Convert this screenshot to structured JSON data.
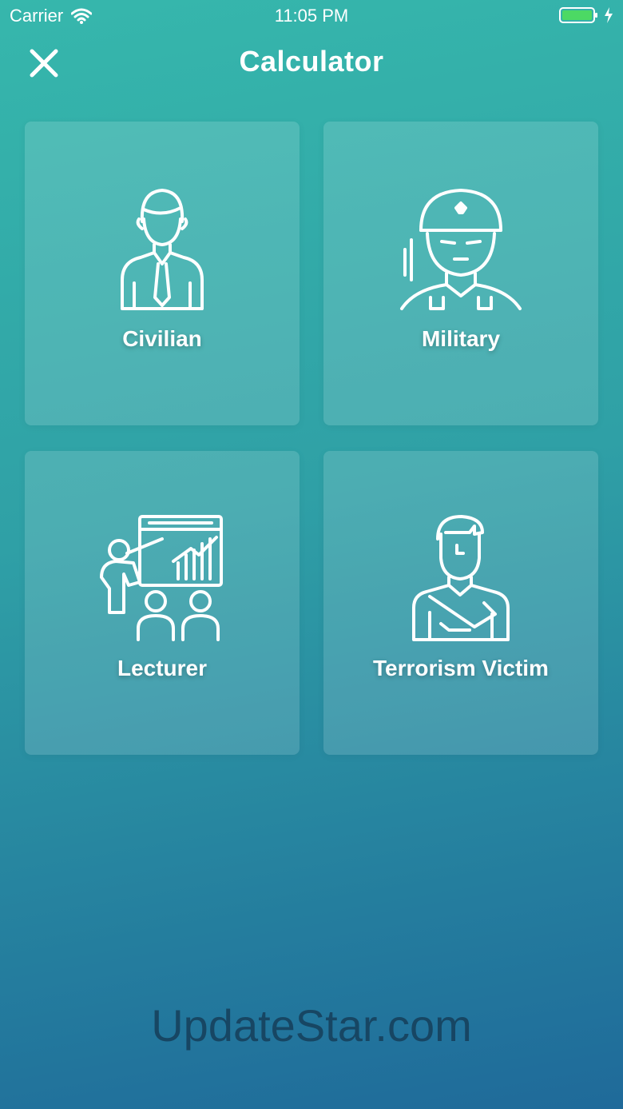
{
  "status_bar": {
    "carrier": "Carrier",
    "time": "11:05 PM",
    "battery_color": "#4cd964"
  },
  "header": {
    "title": "Calculator",
    "close_icon": "close-icon"
  },
  "categories": [
    {
      "label": "Civilian",
      "icon": "civilian-icon"
    },
    {
      "label": "Military",
      "icon": "soldier-icon"
    },
    {
      "label": "Lecturer",
      "icon": "lecturer-icon"
    },
    {
      "label": "Terrorism Victim",
      "icon": "injured-person-icon"
    }
  ],
  "watermark": "UpdateStar.com",
  "colors": {
    "gradient_top": "#36b7ac",
    "gradient_bottom": "#1f6a9a"
  }
}
